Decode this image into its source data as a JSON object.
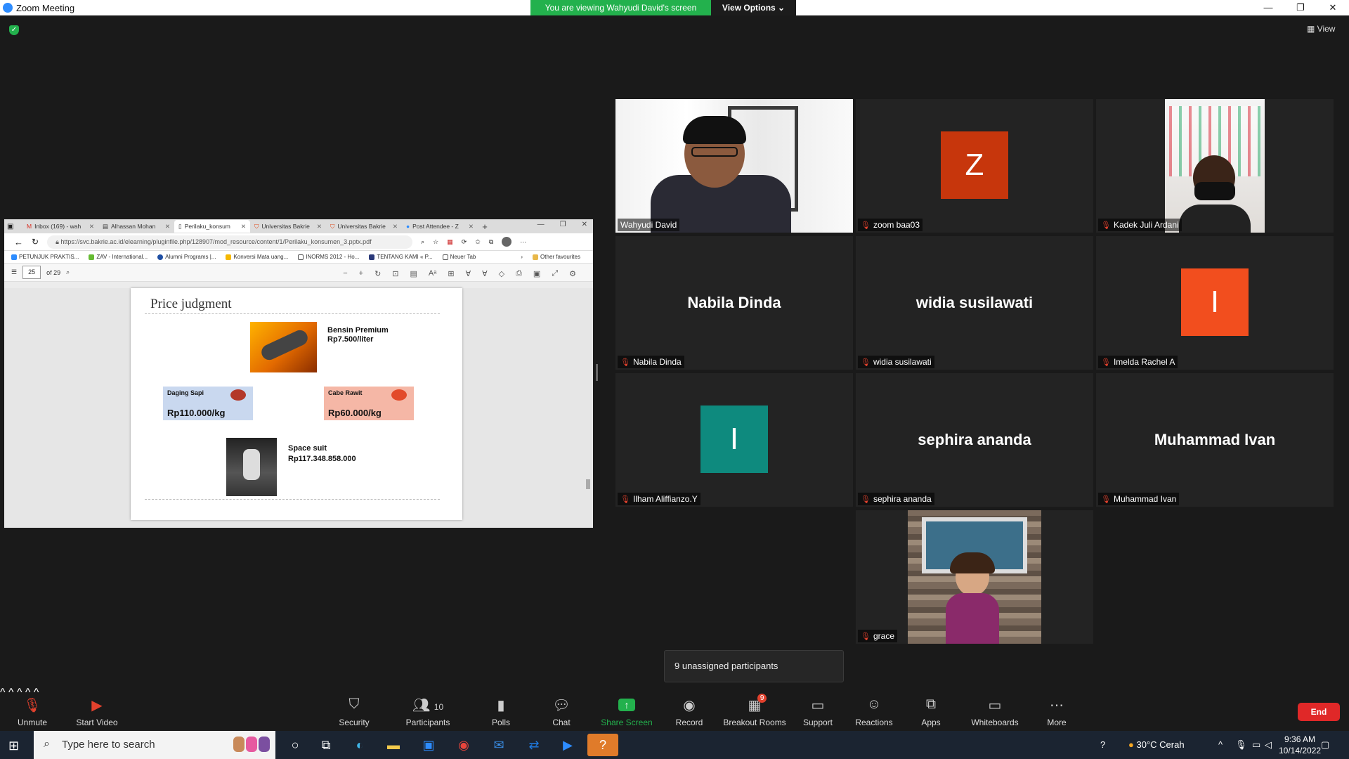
{
  "window": {
    "title": "Zoom Meeting",
    "banner": "You are viewing Wahyudi David's screen",
    "view_options": "View Options ⌄",
    "controls": [
      "—",
      "❐",
      "✕"
    ],
    "view_label": "View"
  },
  "browser": {
    "tabs": [
      {
        "label": "Inbox (169) - wah",
        "icon": "gmail-icon"
      },
      {
        "label": "Alhassan Mohan",
        "icon": "pdf-icon"
      },
      {
        "label": "Perilaku_konsum",
        "icon": "document-icon",
        "active": true
      },
      {
        "label": "Universitas Bakrie",
        "icon": "univ-icon"
      },
      {
        "label": "Universitas Bakrie",
        "icon": "univ-icon"
      },
      {
        "label": "Post Attendee - Z",
        "icon": "zoom-icon"
      }
    ],
    "url": "https://svc.bakrie.ac.id/elearning/pluginfile.php/128907/mod_resource/content/1/Perilaku_konsumen_3.pptx.pdf",
    "bookmarks": [
      "PETUNJUK PRAKTIS...",
      "ZAV - International...",
      "Alumni Programs |...",
      "Konversi Mata uang...",
      "INORMS 2012 - Ho...",
      "TENTANG KAMI « P...",
      "Neuer Tab",
      "Other favourites"
    ],
    "pdf": {
      "page": "25",
      "of": "of 29"
    }
  },
  "slide": {
    "title": "Price judgment",
    "fuel_name": "Bensin Premium",
    "fuel_price": "Rp7.500/liter",
    "beef_label": "Daging Sapi",
    "beef_price": "Rp110.000/kg",
    "chili_label": "Cabe Rawit",
    "chili_price": "Rp60.000/kg",
    "suit_name": "Space suit",
    "suit_price": "Rp117.348.858.000"
  },
  "participants": [
    {
      "name": "Wahyudi David",
      "type": "video",
      "muted": false,
      "active": true
    },
    {
      "name": "zoom baa03",
      "type": "avatar",
      "letter": "Z",
      "color": "#c7360c",
      "muted": true
    },
    {
      "name": "Kadek Juli Ardani",
      "type": "video",
      "muted": true
    },
    {
      "name": "Nabila Dinda",
      "type": "name",
      "muted": true
    },
    {
      "name": "widia susilawati",
      "type": "name",
      "muted": true
    },
    {
      "name": "Imelda Rachel A",
      "type": "avatar",
      "letter": "I",
      "color": "#f24e1e",
      "muted": true
    },
    {
      "name": "Ilham Aliffianzo.Y",
      "type": "avatar",
      "letter": "I",
      "color": "#0e8a7e",
      "muted": true
    },
    {
      "name": "sephira ananda",
      "type": "name",
      "muted": true
    },
    {
      "name": "Muhammad Ivan",
      "type": "name",
      "muted": true
    },
    {
      "name": "grace",
      "type": "video",
      "muted": true
    }
  ],
  "unassigned": "9 unassigned participants",
  "toolbar": {
    "unmute": "Unmute",
    "start_video": "Start Video",
    "security": "Security",
    "participants": "Participants",
    "participants_count": "10",
    "polls": "Polls",
    "chat": "Chat",
    "share_screen": "Share Screen",
    "record": "Record",
    "breakout": "Breakout Rooms",
    "breakout_badge": "9",
    "support": "Support",
    "reactions": "Reactions",
    "apps": "Apps",
    "whiteboards": "Whiteboards",
    "more": "More",
    "end": "End"
  },
  "taskbar": {
    "search_placeholder": "Type here to search",
    "weather": "30°C  Cerah",
    "time": "9:36 AM",
    "date": "10/14/2022"
  },
  "colors": {
    "share_green": "#23b14d",
    "end_red": "#e02828",
    "active_outline": "#b7d94a",
    "muted_red": "#e2412d"
  }
}
